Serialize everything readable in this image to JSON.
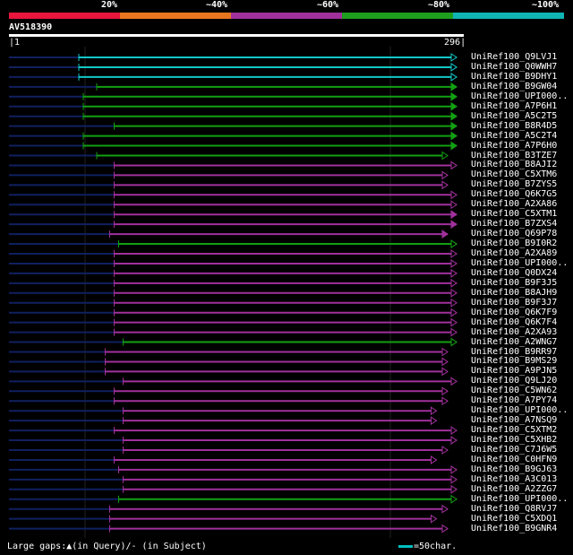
{
  "legend": {
    "labels": [
      "20%",
      "~40%",
      "~60%",
      "~80%",
      "~100%"
    ],
    "colors": [
      "#e8163c",
      "#e8761e",
      "#a0309c",
      "#1ea01e",
      "#10b4b4"
    ]
  },
  "query": {
    "name": "AV518390",
    "start": "1",
    "end": "296"
  },
  "hits": [
    {
      "name": "UniRef100_Q9LVJ1",
      "color": "cyan",
      "start": 0.156,
      "end": 1.0,
      "triangle": true
    },
    {
      "name": "UniRef100_Q0WWH7",
      "color": "cyan",
      "start": 0.156,
      "end": 1.0,
      "triangle": true
    },
    {
      "name": "UniRef100_B9DHY1",
      "color": "cyan",
      "start": 0.156,
      "end": 1.0,
      "triangle": true
    },
    {
      "name": "UniRef100_B9GW04",
      "color": "green",
      "start": 0.196,
      "end": 1.0,
      "triangle": false
    },
    {
      "name": "UniRef100_UPI000..",
      "color": "green",
      "start": 0.166,
      "end": 1.0,
      "triangle": false
    },
    {
      "name": "UniRef100_A7P6H1",
      "color": "green",
      "start": 0.166,
      "end": 1.0,
      "triangle": false
    },
    {
      "name": "UniRef100_A5C2T5",
      "color": "green",
      "start": 0.166,
      "end": 1.0,
      "triangle": false
    },
    {
      "name": "UniRef100_B8R4D5",
      "color": "green",
      "start": 0.235,
      "end": 1.0,
      "triangle": false
    },
    {
      "name": "UniRef100_A5C2T4",
      "color": "green",
      "start": 0.166,
      "end": 1.0,
      "triangle": false
    },
    {
      "name": "UniRef100_A7P6H0",
      "color": "green",
      "start": 0.166,
      "end": 1.0,
      "triangle": false
    },
    {
      "name": "UniRef100_B3TZE7",
      "color": "green",
      "start": 0.196,
      "end": 0.98,
      "triangle": true
    },
    {
      "name": "UniRef100_B8AJI2",
      "color": "purple",
      "start": 0.235,
      "end": 1.0,
      "triangle": true
    },
    {
      "name": "UniRef100_C5XTM6",
      "color": "purple",
      "start": 0.235,
      "end": 0.98,
      "triangle": true
    },
    {
      "name": "UniRef100_B7ZYS5",
      "color": "purple",
      "start": 0.235,
      "end": 0.98,
      "triangle": true
    },
    {
      "name": "UniRef100_Q6K7G5",
      "color": "purple",
      "start": 0.235,
      "end": 1.0,
      "triangle": true
    },
    {
      "name": "UniRef100_A2XA86",
      "color": "purple",
      "start": 0.235,
      "end": 1.0,
      "triangle": true
    },
    {
      "name": "UniRef100_C5XTM1",
      "color": "purple",
      "start": 0.235,
      "end": 1.0,
      "triangle": false
    },
    {
      "name": "UniRef100_B7ZXS4",
      "color": "purple",
      "start": 0.235,
      "end": 1.0,
      "triangle": false
    },
    {
      "name": "UniRef100_Q69P78",
      "color": "purple",
      "start": 0.225,
      "end": 0.98,
      "triangle": false
    },
    {
      "name": "UniRef100_B9I0R2",
      "color": "green",
      "start": 0.245,
      "end": 1.0,
      "triangle": true
    },
    {
      "name": "UniRef100_A2XA89",
      "color": "purple",
      "start": 0.235,
      "end": 1.0,
      "triangle": true
    },
    {
      "name": "UniRef100_UPI000..",
      "color": "purple",
      "start": 0.235,
      "end": 1.0,
      "triangle": true
    },
    {
      "name": "UniRef100_Q0DX24",
      "color": "purple",
      "start": 0.235,
      "end": 1.0,
      "triangle": true
    },
    {
      "name": "UniRef100_B9F3J5",
      "color": "purple",
      "start": 0.235,
      "end": 1.0,
      "triangle": true
    },
    {
      "name": "UniRef100_B8AJH9",
      "color": "purple",
      "start": 0.235,
      "end": 1.0,
      "triangle": true
    },
    {
      "name": "UniRef100_B9F3J7",
      "color": "purple",
      "start": 0.235,
      "end": 1.0,
      "triangle": true
    },
    {
      "name": "UniRef100_Q6K7F9",
      "color": "purple",
      "start": 0.235,
      "end": 1.0,
      "triangle": true
    },
    {
      "name": "UniRef100_Q6K7F4",
      "color": "purple",
      "start": 0.235,
      "end": 1.0,
      "triangle": true
    },
    {
      "name": "UniRef100_A2XA93",
      "color": "purple",
      "start": 0.235,
      "end": 1.0,
      "triangle": true
    },
    {
      "name": "UniRef100_A2WNG7",
      "color": "green",
      "start": 0.255,
      "end": 1.0,
      "triangle": true
    },
    {
      "name": "UniRef100_B9RR97",
      "color": "purple",
      "start": 0.215,
      "end": 0.98,
      "triangle": true
    },
    {
      "name": "UniRef100_B9MS29",
      "color": "purple",
      "start": 0.215,
      "end": 0.98,
      "triangle": true
    },
    {
      "name": "UniRef100_A9PJN5",
      "color": "purple",
      "start": 0.215,
      "end": 0.98,
      "triangle": true
    },
    {
      "name": "UniRef100_Q9LJ20",
      "color": "purple",
      "start": 0.255,
      "end": 1.0,
      "triangle": true
    },
    {
      "name": "UniRef100_C5WN62",
      "color": "purple",
      "start": 0.235,
      "end": 0.98,
      "triangle": true
    },
    {
      "name": "UniRef100_A7PY74",
      "color": "purple",
      "start": 0.235,
      "end": 0.98,
      "triangle": true
    },
    {
      "name": "UniRef100_UPI000..",
      "color": "purple",
      "start": 0.255,
      "end": 0.955,
      "triangle": true
    },
    {
      "name": "UniRef100_A7NSQ9",
      "color": "purple",
      "start": 0.255,
      "end": 0.955,
      "triangle": true
    },
    {
      "name": "UniRef100_C5XTM2",
      "color": "purple",
      "start": 0.235,
      "end": 1.0,
      "triangle": true
    },
    {
      "name": "UniRef100_C5XHB2",
      "color": "purple",
      "start": 0.255,
      "end": 1.0,
      "triangle": true
    },
    {
      "name": "UniRef100_C7J6W5",
      "color": "purple",
      "start": 0.255,
      "end": 0.98,
      "triangle": true
    },
    {
      "name": "UniRef100_C0HFN9",
      "color": "purple",
      "start": 0.235,
      "end": 0.955,
      "triangle": true
    },
    {
      "name": "UniRef100_B9GJ63",
      "color": "purple",
      "start": 0.245,
      "end": 1.0,
      "triangle": true
    },
    {
      "name": "UniRef100_A3C013",
      "color": "purple",
      "start": 0.255,
      "end": 1.0,
      "triangle": true
    },
    {
      "name": "UniRef100_A2ZZG7",
      "color": "purple",
      "start": 0.255,
      "end": 1.0,
      "triangle": true
    },
    {
      "name": "UniRef100_UPI000..",
      "color": "green",
      "start": 0.245,
      "end": 1.0,
      "triangle": true
    },
    {
      "name": "UniRef100_Q8RVJ7",
      "color": "purple",
      "start": 0.225,
      "end": 0.98,
      "triangle": true
    },
    {
      "name": "UniRef100_C5XDQ1",
      "color": "purple",
      "start": 0.225,
      "end": 0.955,
      "triangle": true
    },
    {
      "name": "UniRef100_B9GNR4",
      "color": "purple",
      "start": 0.225,
      "end": 0.98,
      "triangle": true
    }
  ],
  "palette": {
    "cyan": "#10c8c8",
    "green": "#12a012",
    "purple": "#a0309c",
    "tail": "#102060"
  },
  "footer": {
    "gaps_label": "Large gaps:",
    "query_gap": "(in Query)",
    "subject_gap": "/- (in Subject)",
    "scale_label": "=50char."
  }
}
